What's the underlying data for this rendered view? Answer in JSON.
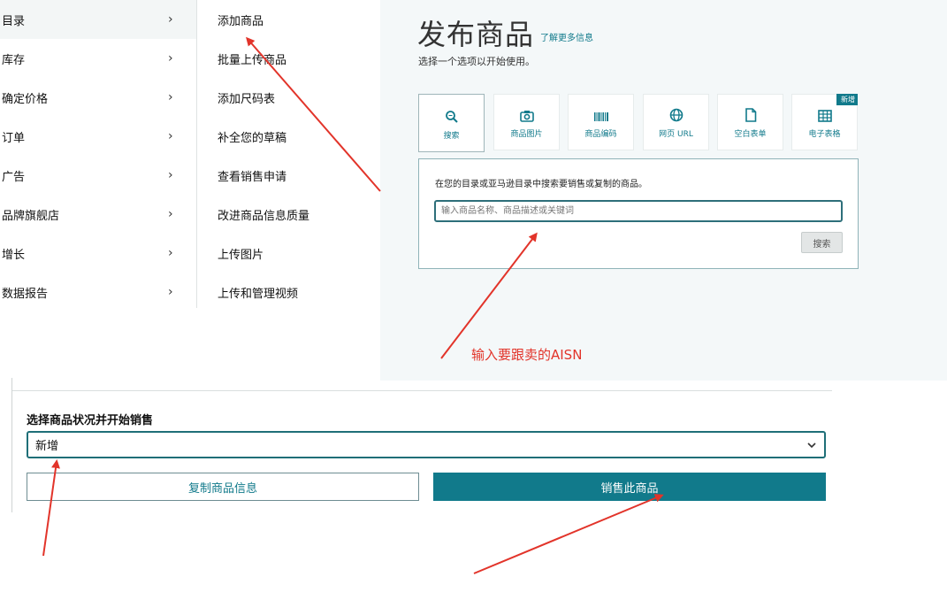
{
  "menu": {
    "items": [
      {
        "label": "目录",
        "active": true
      },
      {
        "label": "库存"
      },
      {
        "label": "确定价格"
      },
      {
        "label": "订单"
      },
      {
        "label": "广告"
      },
      {
        "label": "品牌旗舰店"
      },
      {
        "label": "增长"
      },
      {
        "label": "数据报告"
      }
    ],
    "chevron": "›"
  },
  "submenu": {
    "items": [
      "添加商品",
      "批量上传商品",
      "添加尺码表",
      "补全您的草稿",
      "查看销售申请",
      "改进商品信息质量",
      "上传图片",
      "上传和管理视频"
    ]
  },
  "panel": {
    "title": "发布商品",
    "more_link": "了解更多信息",
    "subtitle": "选择一个选项以开始使用。",
    "tabs": [
      {
        "label": "搜索",
        "icon": "search-icon"
      },
      {
        "label": "商品图片",
        "icon": "camera-icon"
      },
      {
        "label": "商品编码",
        "icon": "barcode-icon"
      },
      {
        "label": "网页 URL",
        "icon": "globe-icon"
      },
      {
        "label": "空白表单",
        "icon": "document-icon"
      },
      {
        "label": "电子表格",
        "icon": "spreadsheet-icon",
        "badge": "新增"
      }
    ],
    "search": {
      "description": "在您的目录或亚马逊目录中搜索要销售或复制的商品。",
      "placeholder": "输入商品名称、商品描述或关键词",
      "button": "搜索"
    }
  },
  "annotation_note": "输入要跟卖的AISN",
  "bottom": {
    "condition_label": "选择商品状况并开始销售",
    "condition_value": "新增",
    "copy_button": "复制商品信息",
    "sell_button": "销售此商品"
  },
  "colors": {
    "accent": "#117a8b",
    "arrow": "#e2342a",
    "panel_bg": "#f4f8f9"
  }
}
